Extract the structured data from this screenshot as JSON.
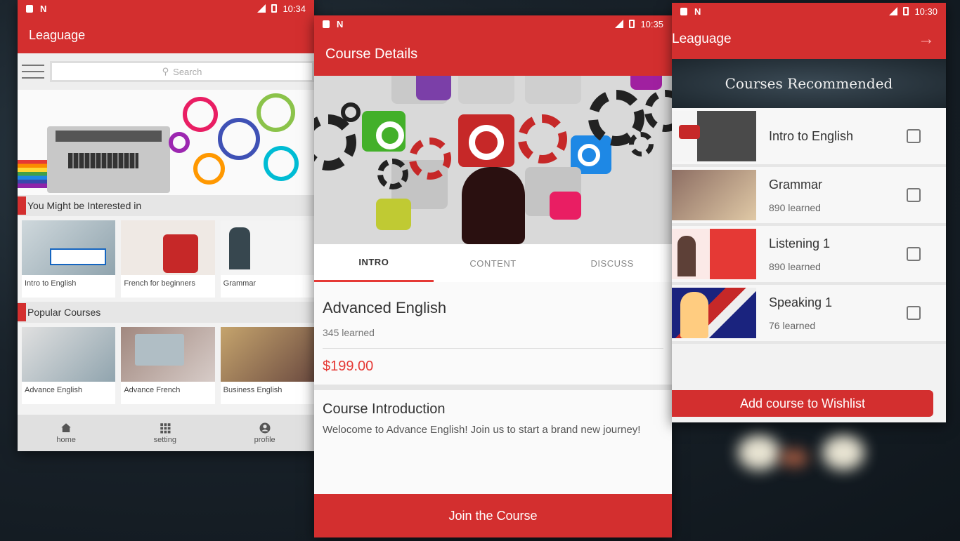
{
  "colors": {
    "primary": "#d32f2f",
    "accent": "#e53935"
  },
  "phone1": {
    "status_time": "10:34",
    "app_title": "Leaguage",
    "search_placeholder": "Search",
    "section_interested": "You Might be Interested in",
    "interested": [
      {
        "label": "Intro to English"
      },
      {
        "label": "French for beginners"
      },
      {
        "label": "Grammar"
      }
    ],
    "section_popular": "Popular Courses",
    "popular": [
      {
        "label": "Advance English"
      },
      {
        "label": "Advance French"
      },
      {
        "label": "Business English"
      }
    ],
    "nav": [
      {
        "label": "home",
        "icon": "home-icon"
      },
      {
        "label": "setting",
        "icon": "grid-icon"
      },
      {
        "label": "profile",
        "icon": "profile-icon"
      }
    ]
  },
  "phone2": {
    "status_time": "10:35",
    "app_title": "Course Details",
    "tabs": [
      "INTRO",
      "CONTENT",
      "DISCUSS"
    ],
    "course_title": "Advanced English",
    "learned": "345 learned",
    "price": "$199.00",
    "intro_heading": "Course Introduction",
    "intro_text": "Welocome to Advance English! Join us to start a brand new journey!",
    "join_label": "Join the Course"
  },
  "phone3": {
    "status_time": "10:30",
    "app_title": "Leaguage",
    "banner_title": "Courses Recommended",
    "courses": [
      {
        "name": "Intro to English",
        "learned": ""
      },
      {
        "name": "Grammar",
        "learned": "890 learned"
      },
      {
        "name": "Listening 1",
        "learned": "890 learned"
      },
      {
        "name": "Speaking 1",
        "learned": "76 learned"
      }
    ],
    "wishlist_label": "Add course to Wishlist"
  }
}
